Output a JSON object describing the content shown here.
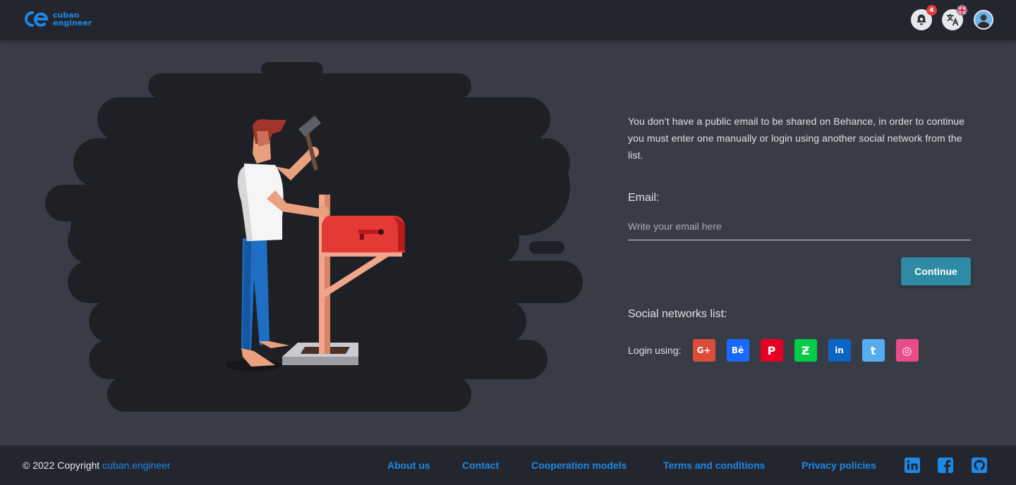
{
  "header": {
    "logo_line1": "cuban",
    "logo_line2": "engineer",
    "notifications_count": "4",
    "language_flag": "uk-flag-icon",
    "avatar": "user-avatar"
  },
  "form": {
    "intro": "You don’t have a public email to be shared on Behance, in order to continue you must enter one manually or login using another social network from the list.",
    "email_label": "Email:",
    "email_placeholder": "Write your email here",
    "email_value": "",
    "continue_label": "Continue",
    "social_title": "Social networks list:",
    "login_label": "Login using:",
    "networks": [
      {
        "name": "google-plus",
        "glyph": "G+",
        "color": "#dd4b39"
      },
      {
        "name": "behance",
        "glyph": "Bē",
        "color": "#1769ff"
      },
      {
        "name": "pinterest",
        "glyph": "P",
        "color": "#e60023"
      },
      {
        "name": "deviantart",
        "glyph": "Ƶ",
        "color": "#05cc47"
      },
      {
        "name": "linkedin",
        "glyph": "in",
        "color": "#0a66c2"
      },
      {
        "name": "twitter",
        "glyph": "t",
        "color": "#55acee"
      },
      {
        "name": "dribbble",
        "glyph": "◎",
        "color": "#ea4c89"
      }
    ]
  },
  "footer": {
    "copyright": "© 2022 Copyright",
    "site": "cuban.engineer",
    "links": [
      "About us",
      "Contact",
      "Cooperation models",
      "Terms and conditions",
      "Privacy policies"
    ]
  },
  "colors": {
    "accent": "#1e88e5",
    "button": "#2e8ba3",
    "background": "#383c47",
    "bar": "#23262e"
  }
}
